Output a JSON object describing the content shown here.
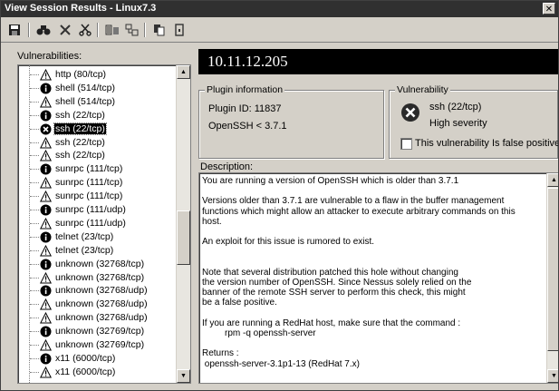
{
  "window": {
    "title": "View Session Results - Linux7.3"
  },
  "toolbar": {
    "buttons": [
      {
        "icon": "save-icon",
        "glyph": "🖫"
      },
      {
        "icon": "find-icon",
        "glyph": "👁"
      },
      {
        "icon": "delete-icon",
        "glyph": "✕"
      },
      {
        "icon": "cut-icon",
        "glyph": "✂"
      },
      {
        "icon": "report-icon",
        "glyph": "▤"
      },
      {
        "icon": "export-icon",
        "glyph": "⊞"
      },
      {
        "icon": "copy-icon",
        "glyph": "❐"
      },
      {
        "icon": "exit-icon",
        "glyph": "▯"
      }
    ]
  },
  "vulnerabilities": {
    "label": "Vulnerabilities:",
    "items": [
      {
        "label": "http (80/tcp)",
        "icon": "warning-icon"
      },
      {
        "label": "shell (514/tcp)",
        "icon": "info-icon"
      },
      {
        "label": "shell (514/tcp)",
        "icon": "warning-icon"
      },
      {
        "label": "ssh (22/tcp)",
        "icon": "info-icon"
      },
      {
        "label": "ssh (22/tcp)",
        "icon": "error-icon",
        "selected": true
      },
      {
        "label": "ssh (22/tcp)",
        "icon": "warning-icon"
      },
      {
        "label": "ssh (22/tcp)",
        "icon": "warning-icon"
      },
      {
        "label": "sunrpc (111/tcp)",
        "icon": "info-icon"
      },
      {
        "label": "sunrpc (111/tcp)",
        "icon": "warning-icon"
      },
      {
        "label": "sunrpc (111/tcp)",
        "icon": "warning-icon"
      },
      {
        "label": "sunrpc (111/udp)",
        "icon": "info-icon"
      },
      {
        "label": "sunrpc (111/udp)",
        "icon": "warning-icon"
      },
      {
        "label": "telnet (23/tcp)",
        "icon": "info-icon"
      },
      {
        "label": "telnet (23/tcp)",
        "icon": "warning-icon"
      },
      {
        "label": "unknown (32768/tcp)",
        "icon": "info-icon"
      },
      {
        "label": "unknown (32768/tcp)",
        "icon": "warning-icon"
      },
      {
        "label": "unknown (32768/udp)",
        "icon": "info-icon"
      },
      {
        "label": "unknown (32768/udp)",
        "icon": "warning-icon"
      },
      {
        "label": "unknown (32768/udp)",
        "icon": "warning-icon"
      },
      {
        "label": "unknown (32769/tcp)",
        "icon": "info-icon"
      },
      {
        "label": "unknown (32769/tcp)",
        "icon": "warning-icon"
      },
      {
        "label": "x11 (6000/tcp)",
        "icon": "info-icon"
      },
      {
        "label": "x11 (6000/tcp)",
        "icon": "warning-icon"
      }
    ]
  },
  "host": {
    "address": "10.11.12.205"
  },
  "plugin_info": {
    "title": "Plugin information",
    "plugin_id": "Plugin ID: 11837",
    "name": "OpenSSH < 3.7.1"
  },
  "vulnerability": {
    "title": "Vulnerability",
    "port": "ssh (22/tcp)",
    "severity": "High severity",
    "false_positive_label": "This vulnerability Is false positive",
    "false_positive_checked": false
  },
  "description": {
    "label": "Description:",
    "text": "You are running a version of OpenSSH which is older than 3.7.1\n\nVersions older than 3.7.1 are vulnerable to a flaw in the buffer management\nfunctions which might allow an attacker to execute arbitrary commands on this\nhost.\n\nAn exploit for this issue is rumored to exist.\n\n\nNote that several distribution patched this hole without changing\nthe version number of OpenSSH. Since Nessus solely relied on the\nbanner of the remote SSH server to perform this check, this might\nbe a false positive.\n\nIf you are running a RedHat host, make sure that the command :\n         rpm -q openssh-server\n\nReturns :\n openssh-server-3.1p1-13 (RedHat 7.x)"
  }
}
